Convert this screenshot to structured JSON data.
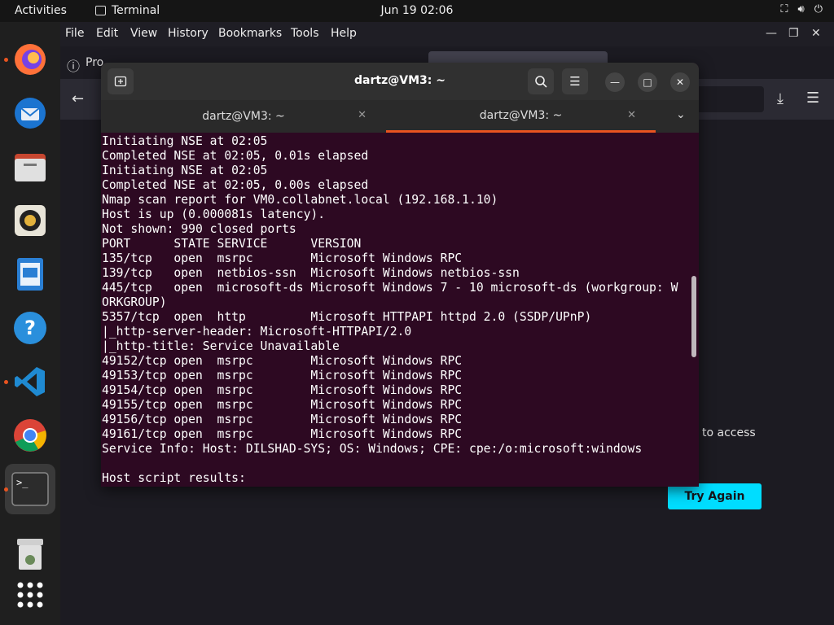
{
  "topbar": {
    "activities": "Activities",
    "app_name": "Terminal",
    "clock": "Jun 19  02:06"
  },
  "dock": {
    "items": [
      "firefox-icon",
      "thunderbird-icon",
      "files-icon",
      "rhythmbox-icon",
      "writer-icon",
      "help-icon",
      "vscode-icon",
      "chrome-icon",
      "terminal-icon",
      "trash-icon",
      "apps-grid-icon"
    ]
  },
  "firefox": {
    "menu": [
      "File",
      "Edit",
      "View",
      "History",
      "Bookmarks",
      "Tools",
      "Help"
    ],
    "partial_text": "Pro",
    "access_text": "to access",
    "try_again": "Try Again"
  },
  "terminal": {
    "title": "dartz@VM3: ~",
    "tabs": [
      "dartz@VM3: ~",
      "dartz@VM3: ~"
    ],
    "lines": [
      "Initiating NSE at 02:05",
      "Completed NSE at 02:05, 0.01s elapsed",
      "Initiating NSE at 02:05",
      "Completed NSE at 02:05, 0.00s elapsed",
      "Nmap scan report for VM0.collabnet.local (192.168.1.10)",
      "Host is up (0.000081s latency).",
      "Not shown: 990 closed ports",
      "PORT      STATE SERVICE      VERSION",
      "135/tcp   open  msrpc        Microsoft Windows RPC",
      "139/tcp   open  netbios-ssn  Microsoft Windows netbios-ssn",
      "445/tcp   open  microsoft-ds Microsoft Windows 7 - 10 microsoft-ds (workgroup: W",
      "ORKGROUP)",
      "5357/tcp  open  http         Microsoft HTTPAPI httpd 2.0 (SSDP/UPnP)",
      "|_http-server-header: Microsoft-HTTPAPI/2.0",
      "|_http-title: Service Unavailable",
      "49152/tcp open  msrpc        Microsoft Windows RPC",
      "49153/tcp open  msrpc        Microsoft Windows RPC",
      "49154/tcp open  msrpc        Microsoft Windows RPC",
      "49155/tcp open  msrpc        Microsoft Windows RPC",
      "49156/tcp open  msrpc        Microsoft Windows RPC",
      "49161/tcp open  msrpc        Microsoft Windows RPC",
      "Service Info: Host: DILSHAD-SYS; OS: Windows; CPE: cpe:/o:microsoft:windows",
      "",
      "Host script results:"
    ]
  },
  "colors": {
    "terminal_bg": "#2d0922",
    "accent": "#e95420",
    "try_again_bg": "#00ddff"
  }
}
